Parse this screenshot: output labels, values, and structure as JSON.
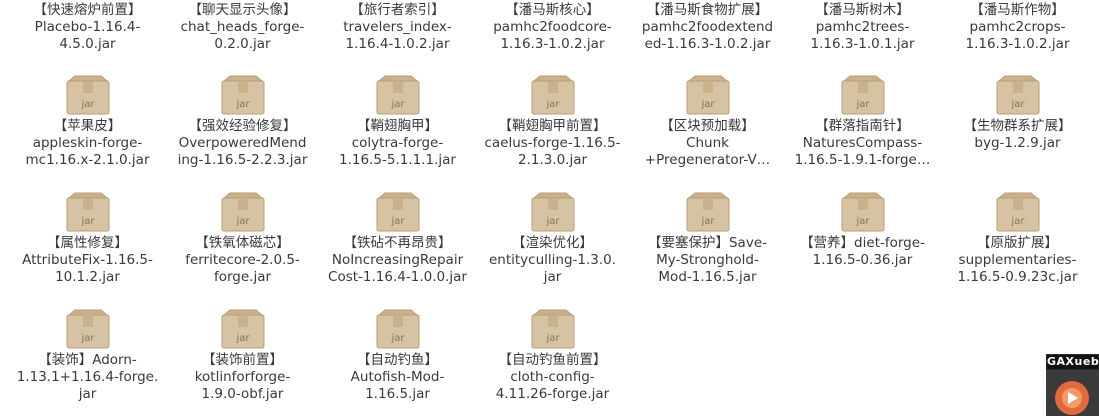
{
  "files": [
    {
      "name": "【快速熔炉前置】\nPlacebo-1.16.4-\n4.5.0.jar",
      "icon": "jar-file-icon",
      "show_icon": false
    },
    {
      "name": "【聊天显示头像】\nchat_heads_forge-\n0.2.0.jar",
      "icon": "jar-file-icon",
      "show_icon": false
    },
    {
      "name": "【旅行者索引】\ntravelers_index-\n1.16.4-1.0.2.jar",
      "icon": "jar-file-icon",
      "show_icon": false
    },
    {
      "name": "【潘马斯核心】\npamhc2foodcore-\n1.16.3-1.0.2.jar",
      "icon": "jar-file-icon",
      "show_icon": false
    },
    {
      "name": "【潘马斯食物扩展】\npamhc2foodextend\ned-1.16.3-1.0.2.jar",
      "icon": "jar-file-icon",
      "show_icon": false
    },
    {
      "name": "【潘马斯树木】\npamhc2trees-\n1.16.3-1.0.1.jar",
      "icon": "jar-file-icon",
      "show_icon": false
    },
    {
      "name": "【潘马斯作物】\npamhc2crops-\n1.16.3-1.0.2.jar",
      "icon": "jar-file-icon",
      "show_icon": false
    },
    {
      "name": "【苹果皮】\nappleskin-forge-\nmc1.16.x-2.1.0.jar",
      "icon": "jar-file-icon",
      "show_icon": true
    },
    {
      "name": "【强效经验修复】\nOverpoweredMend\ning-1.16.5-2.2.3.jar",
      "icon": "jar-file-icon",
      "show_icon": true
    },
    {
      "name": "【鞘翅胸甲】\ncolytra-forge-\n1.16.5-5.1.1.1.jar",
      "icon": "jar-file-icon",
      "show_icon": true
    },
    {
      "name": "【鞘翅胸甲前置】\ncaelus-forge-1.16.5-\n2.1.3.0.jar",
      "icon": "jar-file-icon",
      "show_icon": true
    },
    {
      "name": "【区块预加载】\nChunk\n+Pregenerator-V…",
      "icon": "jar-file-icon",
      "show_icon": true
    },
    {
      "name": "【群落指南针】\nNaturesCompass-\n1.16.5-1.9.1-forge…",
      "icon": "jar-file-icon",
      "show_icon": true
    },
    {
      "name": "【生物群系扩展】\nbyg-1.2.9.jar",
      "icon": "jar-file-icon",
      "show_icon": true
    },
    {
      "name": "【属性修复】\nAttributeFix-1.16.5-\n10.1.2.jar",
      "icon": "jar-file-icon",
      "show_icon": true
    },
    {
      "name": "【铁氧体磁芯】\nferritecore-2.0.5-\nforge.jar",
      "icon": "jar-file-icon",
      "show_icon": true
    },
    {
      "name": "【铁砧不再昂贵】\nNoIncreasingRepair\nCost-1.16.4-1.0.0.jar",
      "icon": "jar-file-icon",
      "show_icon": true
    },
    {
      "name": "【渲染优化】\nentityculling-1.3.0.\njar",
      "icon": "jar-file-icon",
      "show_icon": true
    },
    {
      "name": "【要塞保护】Save-\nMy-Stronghold-\nMod-1.16.5.jar",
      "icon": "jar-file-icon",
      "show_icon": true
    },
    {
      "name": "【营养】diet-forge-\n1.16.5-0.36.jar",
      "icon": "jar-file-icon",
      "show_icon": true
    },
    {
      "name": "【原版扩展】\nsupplementaries-\n1.16.5-0.9.23c.jar",
      "icon": "jar-file-icon",
      "show_icon": true
    },
    {
      "name": "【装饰】Adorn-\n1.13.1+1.16.4-forge.\njar",
      "icon": "jar-file-icon",
      "show_icon": true
    },
    {
      "name": "【装饰前置】\nkotlinforforge-\n1.9.0-obf.jar",
      "icon": "jar-file-icon",
      "show_icon": true
    },
    {
      "name": "【自动钓鱼】\nAutofish-Mod-\n1.16.5.jar",
      "icon": "jar-file-icon",
      "show_icon": true
    },
    {
      "name": "【自动钓鱼前置】\ncloth-config-\n4.11.26-forge.jar",
      "icon": "jar-file-icon",
      "show_icon": true
    }
  ],
  "jar_label": "jar",
  "overlay": {
    "label": "GAXueb",
    "icon": "app-icon"
  },
  "colors": {
    "box_light": "#d6c3a4",
    "box_dark": "#b99c74",
    "box_tape": "#c9b18c",
    "text": "#3a3a3a"
  }
}
